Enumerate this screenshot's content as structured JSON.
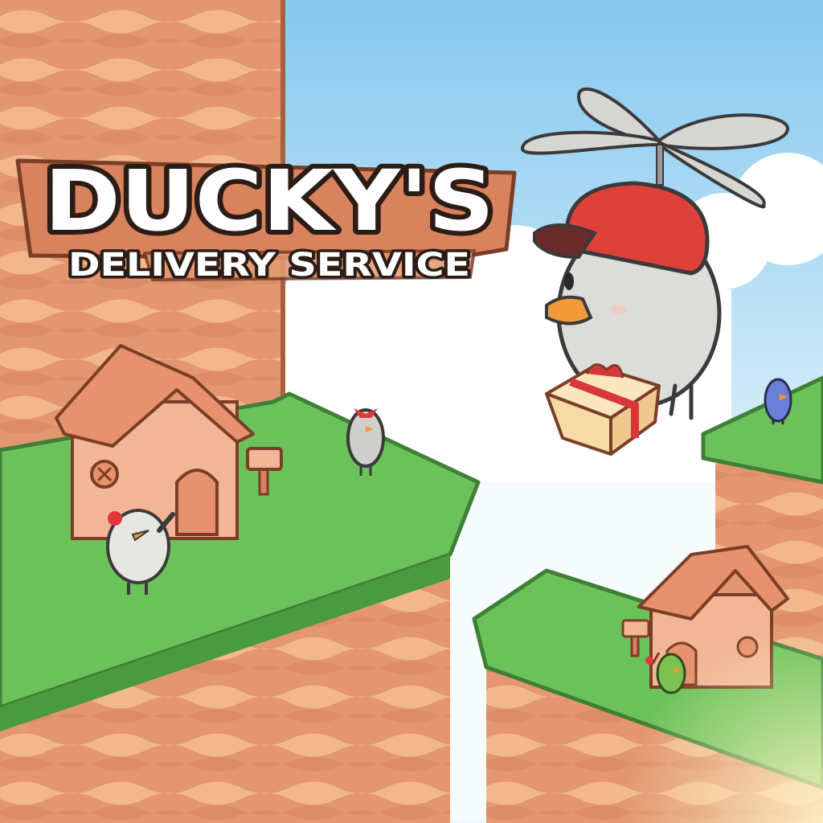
{
  "game": {
    "title": "DUCKY'S",
    "subtitle": "DELIVERY SERVICE"
  },
  "colors": {
    "sky_top": "#8fcdf2",
    "sky_bottom": "#d8effa",
    "cloud": "#ffffff",
    "cliff": "#e59a72",
    "cliff_wave": "#f3b98f",
    "cliff_dark": "#c97a55",
    "grass": "#6cc25a",
    "grass_dark": "#4a9a3f",
    "house_wall": "#f2b596",
    "house_roof": "#e8916e",
    "sign_board": "#d9835e",
    "title_fill": "#ffffff",
    "title_outline": "#2b1c16",
    "hat_red": "#e0403a",
    "bird_grey": "#d9d9d6",
    "beak_orange": "#f29a3a",
    "gift_box": "#f7dba6",
    "ribbon": "#d9363a",
    "bird_blue": "#6a7fd8",
    "bird_green": "#7cc24f"
  },
  "sprites": {
    "hero": "propeller-cap-duck-courier",
    "package": "gift-box-with-red-ribbon",
    "npcs": [
      "flower-duck-waving",
      "bow-chick-standing",
      "blue-bird-on-ledge",
      "green-bird-with-flag"
    ],
    "buildings": [
      "large-brick-house",
      "small-brick-house"
    ],
    "props": [
      "mailbox-left",
      "mailbox-right"
    ]
  }
}
